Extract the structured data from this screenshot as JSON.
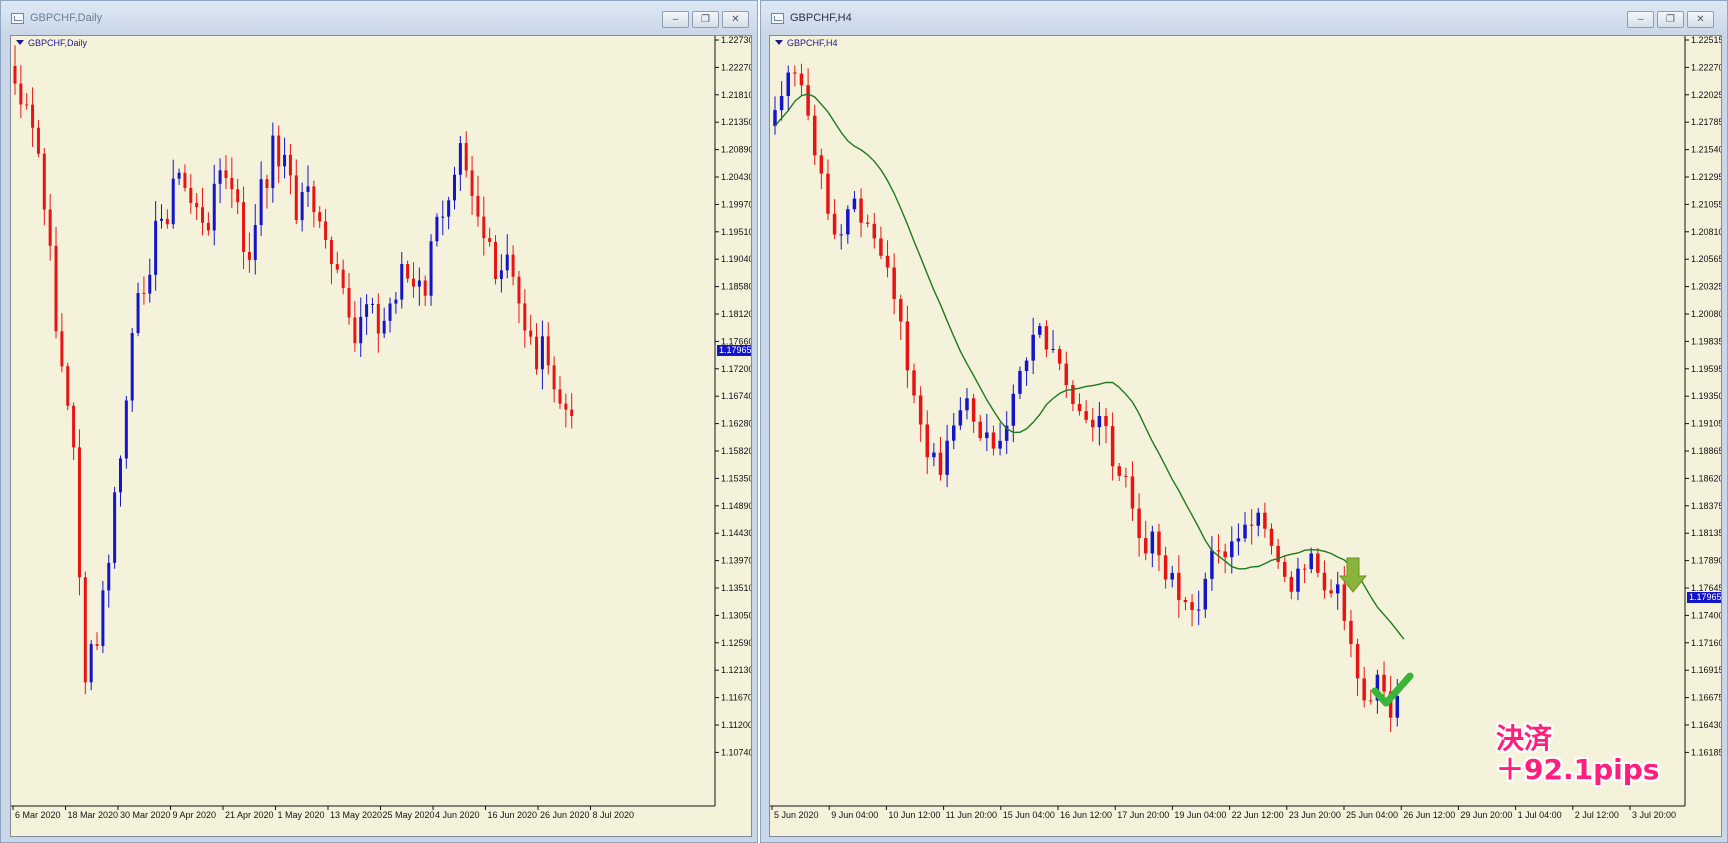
{
  "left_window": {
    "title": "GBPCHF,Daily",
    "chart_label": "GBPCHF,Daily",
    "current_price": "1.17965",
    "y_ticks": [
      "1.22730",
      "1.22270",
      "1.21810",
      "1.21350",
      "1.20890",
      "1.20430",
      "1.19970",
      "1.19510",
      "1.19040",
      "1.18580",
      "1.18120",
      "1.17660",
      "1.17200",
      "1.16740",
      "1.16280",
      "1.15820",
      "1.15350",
      "1.14890",
      "1.14430",
      "1.13970",
      "1.13510",
      "1.13050",
      "1.12590",
      "1.12130",
      "1.11670",
      "1.11200",
      "1.10740"
    ],
    "x_ticks": [
      "6 Mar 2020",
      "18 Mar 2020",
      "30 Mar 2020",
      "9 Apr 2020",
      "21 Apr 2020",
      "1 May 2020",
      "13 May 2020",
      "25 May 2020",
      "4 Jun 2020",
      "16 Jun 2020",
      "26 Jun 2020",
      "8 Jul 2020"
    ]
  },
  "right_window": {
    "title": "GBPCHF,H4",
    "chart_label": "GBPCHF,H4",
    "current_price": "1.17965",
    "y_ticks": [
      "1.22515",
      "1.22270",
      "1.22025",
      "1.21785",
      "1.21540",
      "1.21295",
      "1.21055",
      "1.20810",
      "1.20565",
      "1.20325",
      "1.20080",
      "1.19835",
      "1.19595",
      "1.19350",
      "1.19105",
      "1.18865",
      "1.18620",
      "1.18375",
      "1.18135",
      "1.17890",
      "1.17645",
      "1.17400",
      "1.17160",
      "1.16915",
      "1.16675",
      "1.16430",
      "1.16185"
    ],
    "x_ticks": [
      "5 Jun 2020",
      "9 Jun 04:00",
      "10 Jun 12:00",
      "11 Jun 20:00",
      "15 Jun 04:00",
      "16 Jun 12:00",
      "17 Jun 20:00",
      "19 Jun 04:00",
      "22 Jun 12:00",
      "23 Jun 20:00",
      "25 Jun 04:00",
      "26 Jun 12:00",
      "29 Jun 20:00",
      "1 Jul 04:00",
      "2 Jul 12:00",
      "3 Jul 20:00"
    ],
    "moving_average_color": "#1f7a1f",
    "annotation_line1": "決済",
    "annotation_line2": "＋92.1pips"
  },
  "window_controls": {
    "minimize": "–",
    "restore": "❐",
    "close": "✕"
  },
  "colors": {
    "bull": "#1414c8",
    "bear": "#e81414",
    "chart_bg": "#f5f2dc",
    "annotation": "#ff1f7a",
    "arrow": "#8ab43a",
    "check": "#3ab53a"
  },
  "icons": [
    "chart-window-icon",
    "minimize-icon",
    "restore-icon",
    "close-icon",
    "down-arrow-icon",
    "checkmark-icon"
  ]
}
